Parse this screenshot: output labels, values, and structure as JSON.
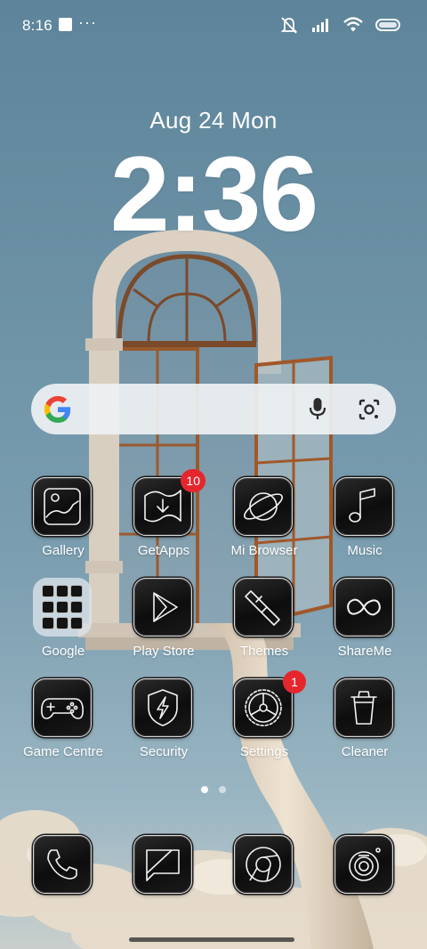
{
  "status_bar": {
    "time": "8:16",
    "overflow": "···",
    "icons": [
      "notification-square-icon",
      "mute-icon",
      "signal-icon",
      "wifi-icon",
      "battery-icon"
    ]
  },
  "lock": {
    "date": "Aug 24 Mon",
    "time": "2:36"
  },
  "search": {
    "icons": [
      "google-logo-icon",
      "mic-icon",
      "lens-icon"
    ]
  },
  "apps": [
    {
      "label": "Gallery",
      "icon": "gallery-icon"
    },
    {
      "label": "GetApps",
      "icon": "getapps-icon",
      "badge": "10"
    },
    {
      "label": "Mi Browser",
      "icon": "browser-icon"
    },
    {
      "label": "Music",
      "icon": "music-icon"
    },
    {
      "label": "Google",
      "icon": "google-folder-icon"
    },
    {
      "label": "Play Store",
      "icon": "play-store-icon"
    },
    {
      "label": "Themes",
      "icon": "themes-icon"
    },
    {
      "label": "ShareMe",
      "icon": "shareme-icon"
    },
    {
      "label": "Game Centre",
      "icon": "gamepad-icon"
    },
    {
      "label": "Security",
      "icon": "security-icon"
    },
    {
      "label": "Settings",
      "icon": "settings-icon",
      "badge": "1"
    },
    {
      "label": "Cleaner",
      "icon": "cleaner-icon"
    }
  ],
  "dock": [
    "phone-icon",
    "messages-icon",
    "chrome-icon",
    "camera-icon"
  ],
  "page_indicator": {
    "pages": 2,
    "current": 1
  },
  "colors": {
    "badge": "#e6262d",
    "sky": "#6e93a7",
    "tile": "#111111"
  }
}
